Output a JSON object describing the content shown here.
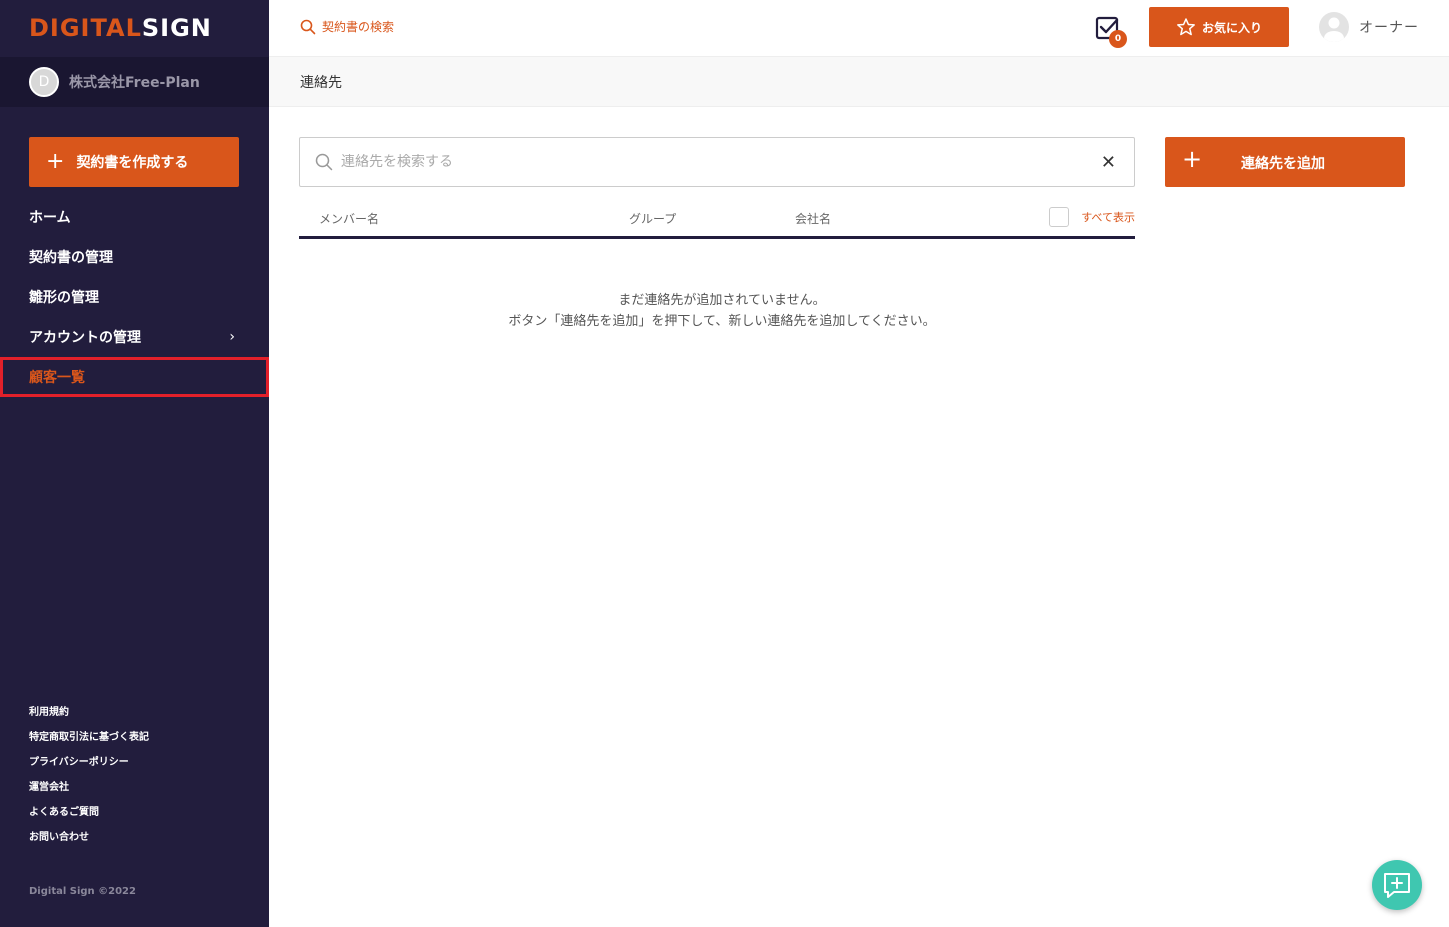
{
  "brand": {
    "logo_orange": "DIGITAL",
    "logo_white": "SIGN",
    "accent": "#d9561b",
    "sidebar_bg": "#221d3d"
  },
  "org": {
    "initial": "D",
    "name": "株式会社Free-Plan"
  },
  "sidebar": {
    "create_button": "契約書を作成する",
    "items": [
      {
        "label": "ホーム"
      },
      {
        "label": "契約書の管理"
      },
      {
        "label": "雛形の管理"
      },
      {
        "label": "アカウントの管理",
        "chevron": "›"
      },
      {
        "label": "顧客一覧"
      }
    ],
    "footer_links": [
      "利用規約",
      "特定商取引法に基づく表記",
      "プライバシーポリシー",
      "運営会社",
      "よくあるご質問",
      "お問い合わせ"
    ],
    "copyright": "Digital Sign ©2022"
  },
  "header": {
    "search_label": "契約書の検索",
    "task_count": "0",
    "favorites_label": "お気に入り",
    "user_name": "オーナー"
  },
  "breadcrumb": {
    "title": "連絡先"
  },
  "main": {
    "search_placeholder": "連絡先を検索する",
    "clear_icon": "✕",
    "add_button": "連絡先を追加",
    "columns": [
      "メンバー名",
      "グループ",
      "会社名"
    ],
    "show_all_label": "すべて表示",
    "empty_line1": "まだ連絡先が追加されていません。",
    "empty_line2": "ボタン「連絡先を追加」を押下して、新しい連絡先を追加してください。"
  }
}
